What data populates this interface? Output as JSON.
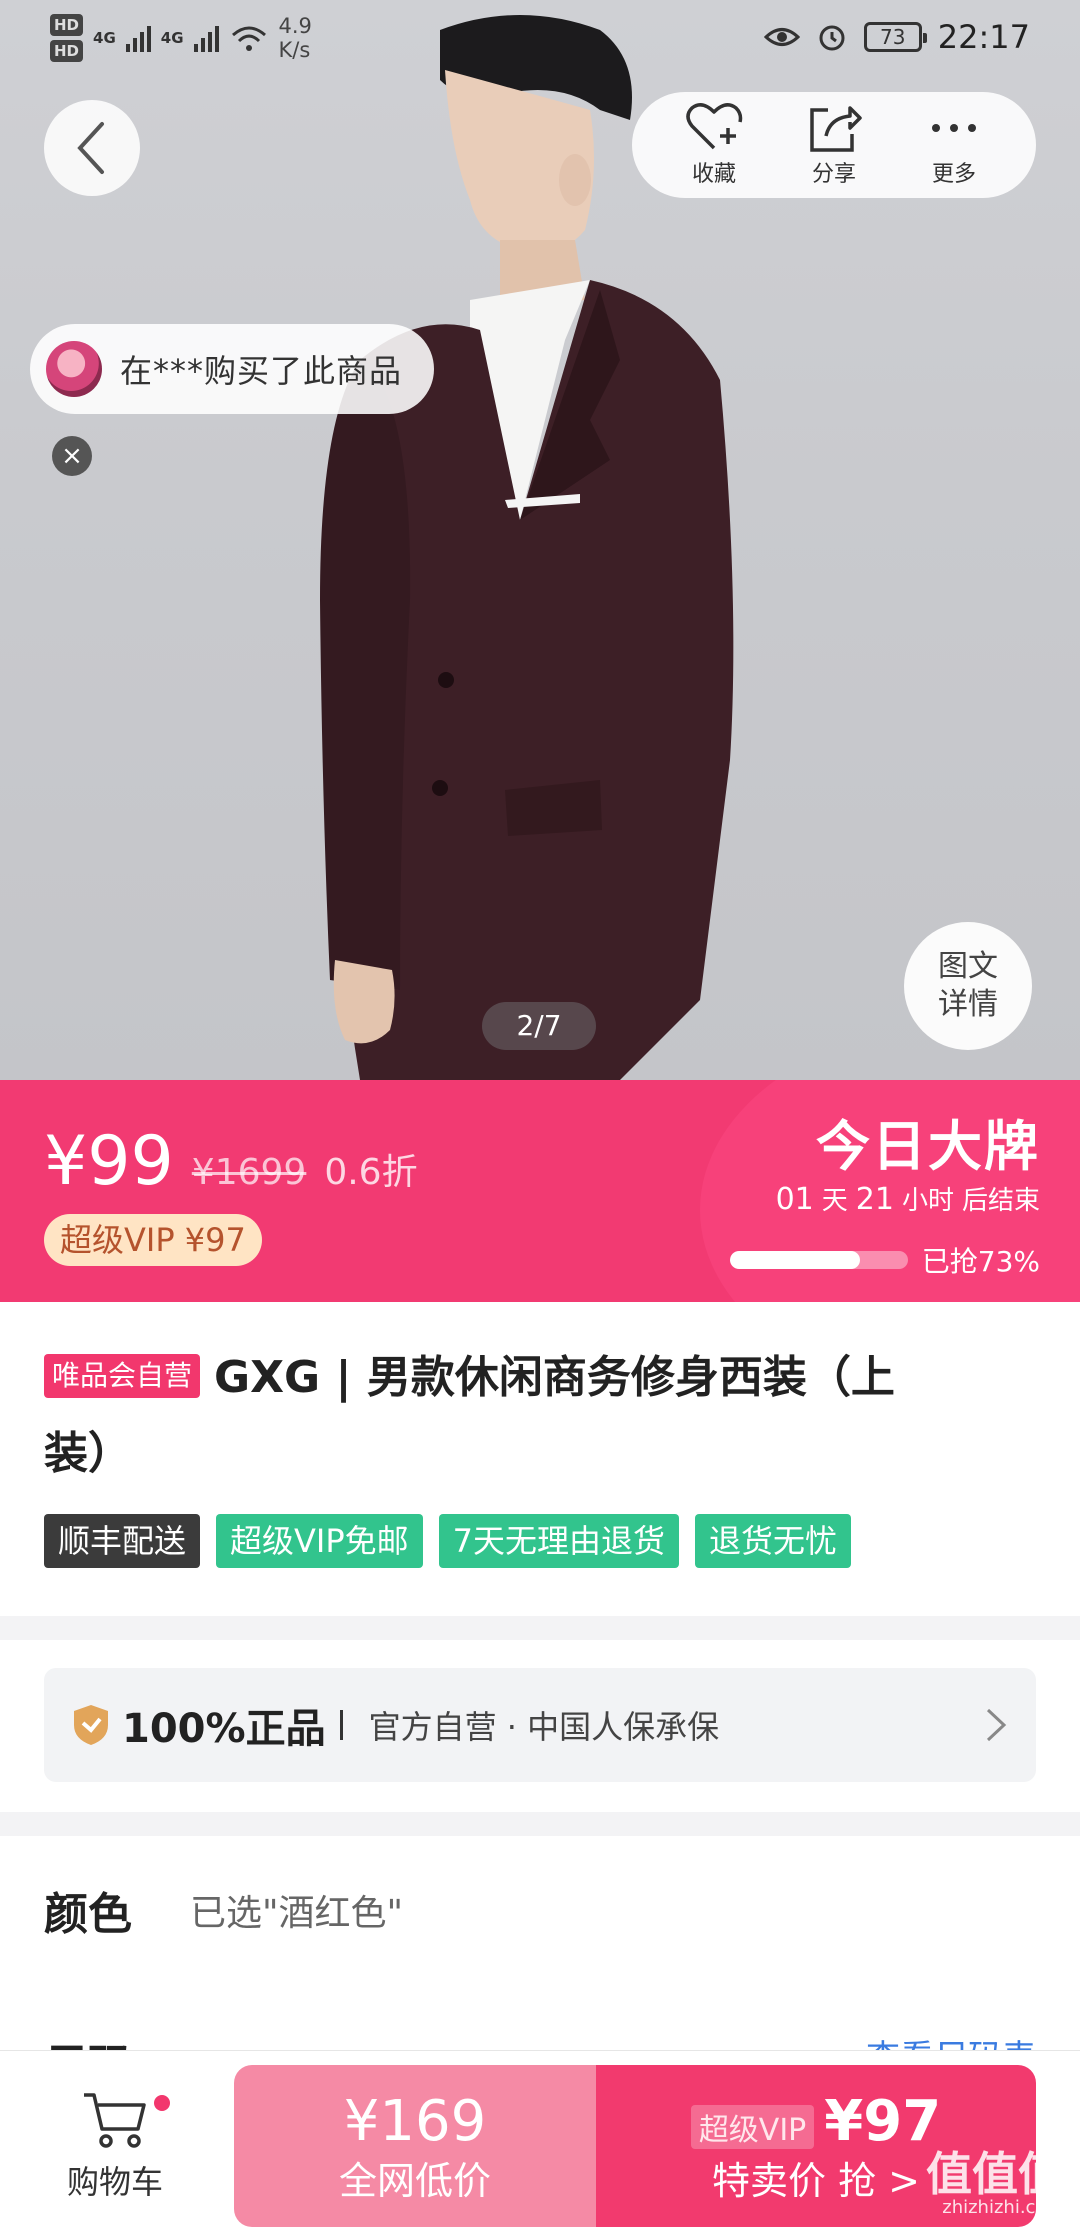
{
  "status_bar": {
    "hd1": "HD",
    "hd2": "HD",
    "net1": "4G",
    "net2": "4G",
    "speed_value": "4.9",
    "speed_unit": "K/s",
    "battery": "73",
    "time": "22:17"
  },
  "header": {
    "favorite_label": "收藏",
    "share_label": "分享",
    "more_label": "更多"
  },
  "gallery": {
    "buyer_notice": "在***购买了此商品",
    "close_symbol": "×",
    "detail_line1": "图文",
    "detail_line2": "详情",
    "pager": "2/7"
  },
  "price_banner": {
    "price": "¥99",
    "original_price": "¥1699",
    "discount": "0.6折",
    "vip_price": "超级VIP ¥97",
    "deal_title": "今日大牌",
    "days": "01",
    "days_unit": "天",
    "hours": "21",
    "hours_unit": "小时",
    "ends_text": "后结束",
    "sold_text": "已抢73%",
    "sold_fraction": 0.73,
    "accent_color": "#f23a72"
  },
  "product": {
    "self_tag": "唯品会自营",
    "title_line1": "GXG | 男款休闲商务修身西装（上",
    "title_line2": "装）",
    "tags": [
      "顺丰配送",
      "超级VIP免邮",
      "7天无理由退货",
      "退货无忧"
    ]
  },
  "guarantee": {
    "strong": "100%正品",
    "text": "官方自营 · 中国人保承保",
    "icon": "shield-icon"
  },
  "options": {
    "color_label": "颜色",
    "color_value": "已选\"酒红色\"",
    "size_label": "尺码",
    "size_link": "查看尺码表"
  },
  "bottom_bar": {
    "cart_label": "购物车",
    "market_price": "¥169",
    "market_label": "全网低价",
    "vip_tag": "超级VIP",
    "buy_price": "¥97",
    "buy_label": "特卖价 抢 >"
  },
  "watermark": {
    "main": "值值值",
    "site": "zhizhizhi.com"
  }
}
